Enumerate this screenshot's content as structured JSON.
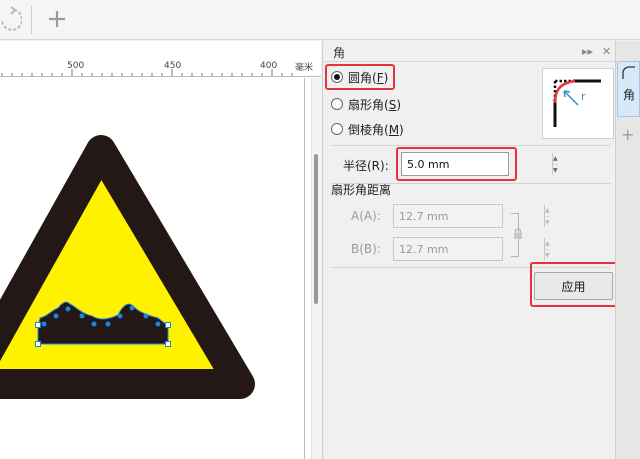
{
  "canvas": {
    "ruler_labels": [
      "500",
      "450",
      "400"
    ],
    "ruler_unit": "毫米"
  },
  "panel": {
    "title": "角",
    "corner_types": [
      {
        "label": "圆角(",
        "key": "F",
        "selected": true
      },
      {
        "label": "扇形角(",
        "key": "S",
        "selected": false
      },
      {
        "label": "倒棱角(",
        "key": "M",
        "selected": false
      }
    ],
    "radius": {
      "label": "半径(R):",
      "value": "5.0 mm"
    },
    "scallop": {
      "section_label": "扇形角距离",
      "a_label": "A(A):",
      "a_value": "12.7 mm",
      "b_label": "B(B):",
      "b_value": "12.7 mm"
    },
    "apply_label": "应用",
    "preview_label": "r"
  },
  "tab_strip": {
    "active_tab_label": "角"
  },
  "colors": {
    "highlight": "#e8323c",
    "sign_yellow": "#fff200",
    "sign_border": "#231815",
    "selection": "#1b84e2"
  }
}
